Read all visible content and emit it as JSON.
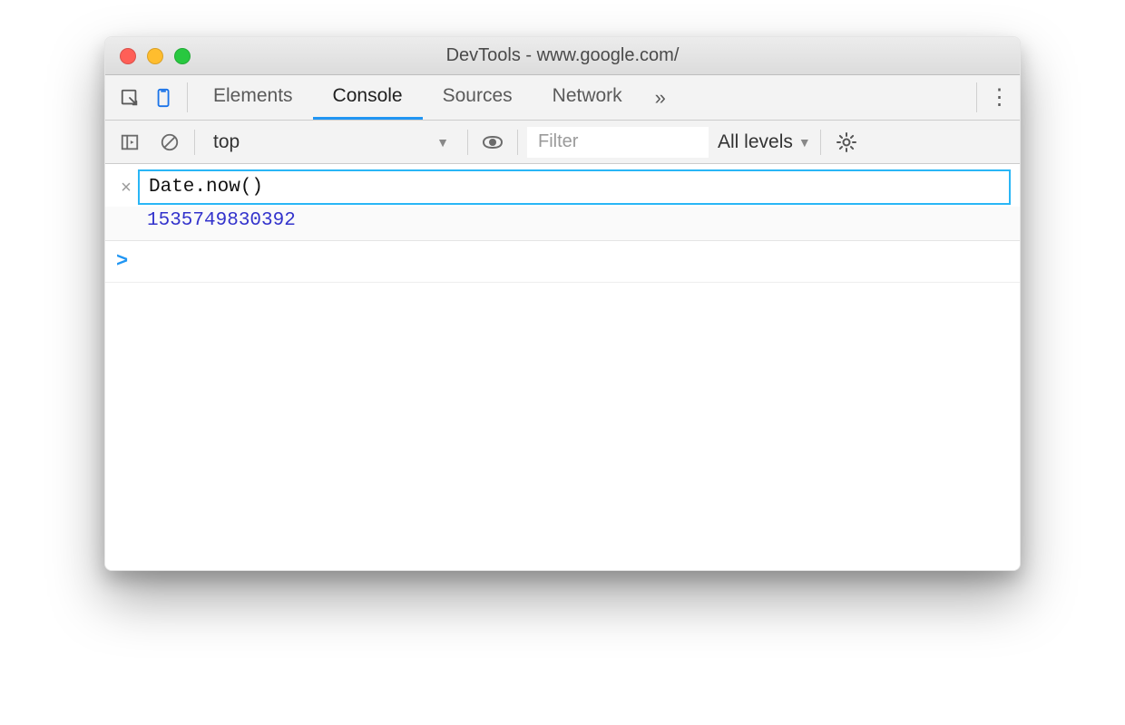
{
  "window": {
    "title": "DevTools - www.google.com/"
  },
  "tabs": {
    "items": [
      "Elements",
      "Console",
      "Sources",
      "Network"
    ],
    "active": "Console"
  },
  "filter": {
    "context": "top",
    "placeholder": "Filter",
    "levels_label": "All levels"
  },
  "console": {
    "live_expression": "Date.now()",
    "live_result": "1535749830392",
    "prompt": ">"
  },
  "icons": {
    "close_x": "×",
    "overflow": "»",
    "kebab": "⋮",
    "caret": "▼"
  }
}
